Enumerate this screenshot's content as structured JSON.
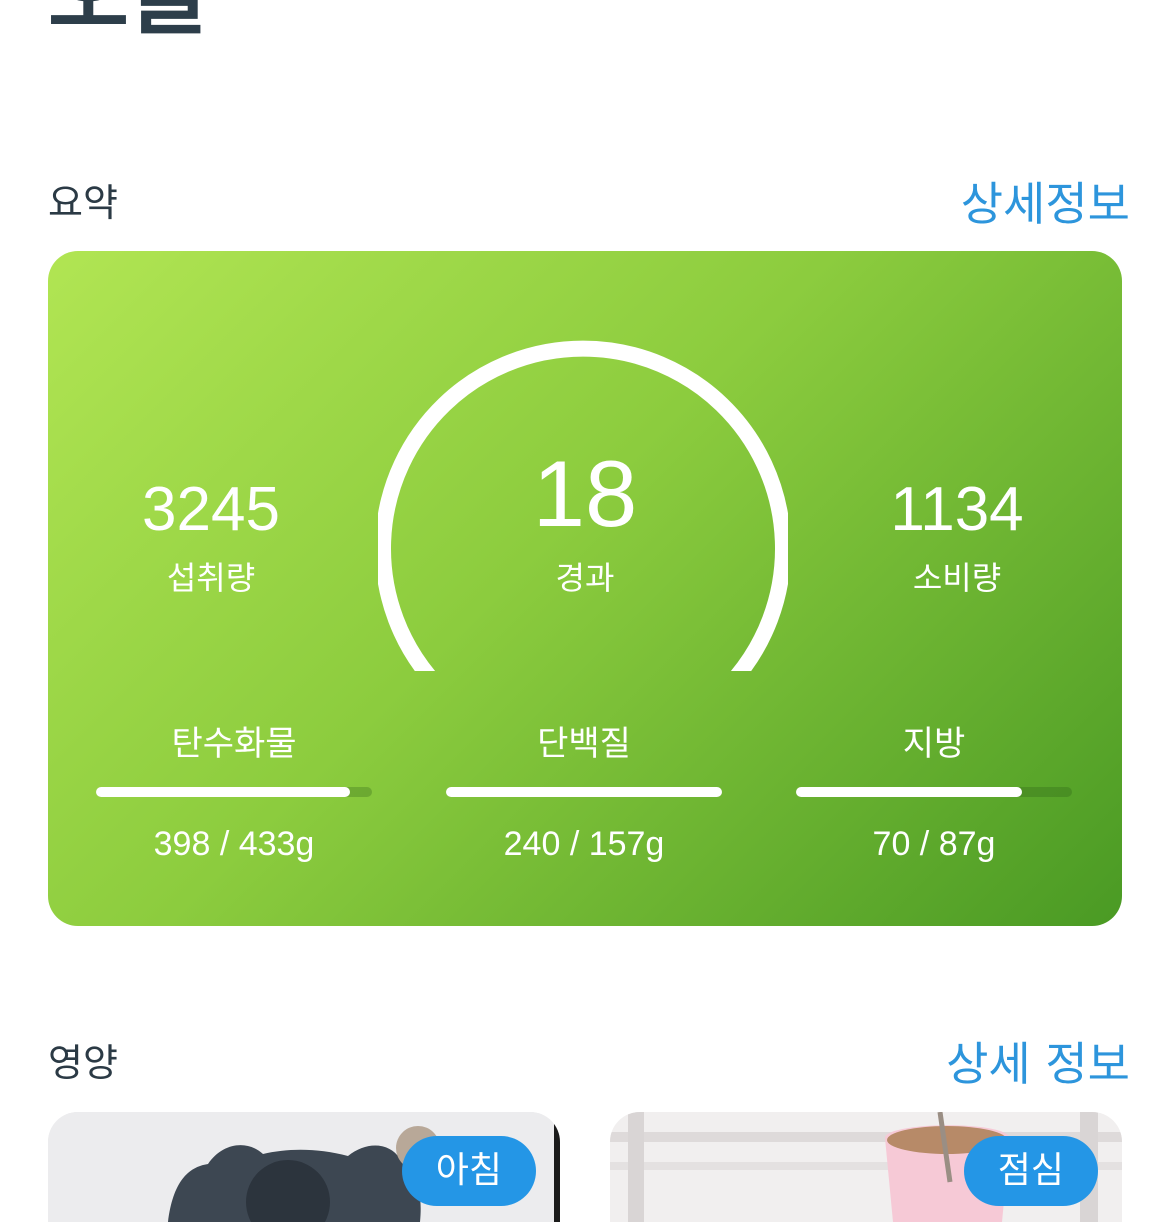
{
  "page": {
    "title": "오늘"
  },
  "summary": {
    "label": "요약",
    "detail_link": "상세정보",
    "intake": {
      "value": "3245",
      "label": "섭취량"
    },
    "elapsed": {
      "value": "18",
      "label": "경과"
    },
    "burned": {
      "value": "1134",
      "label": "소비량"
    },
    "macros": [
      {
        "name": "탄수화물",
        "value_text": "398 / 433g",
        "progress": 0.92
      },
      {
        "name": "단백질",
        "value_text": "240 / 157g",
        "progress": 1.0
      },
      {
        "name": "지방",
        "value_text": "70 / 87g",
        "progress": 0.82
      }
    ]
  },
  "nutrition": {
    "label": "영양",
    "detail_link": "상세 정보",
    "meals": [
      {
        "badge": "아침"
      },
      {
        "badge": "점심"
      }
    ]
  },
  "colors": {
    "accent_blue": "#2d95dc",
    "badge_blue": "#2496e6",
    "card_green_start": "#b1e553",
    "card_green_end": "#4a9a24"
  }
}
